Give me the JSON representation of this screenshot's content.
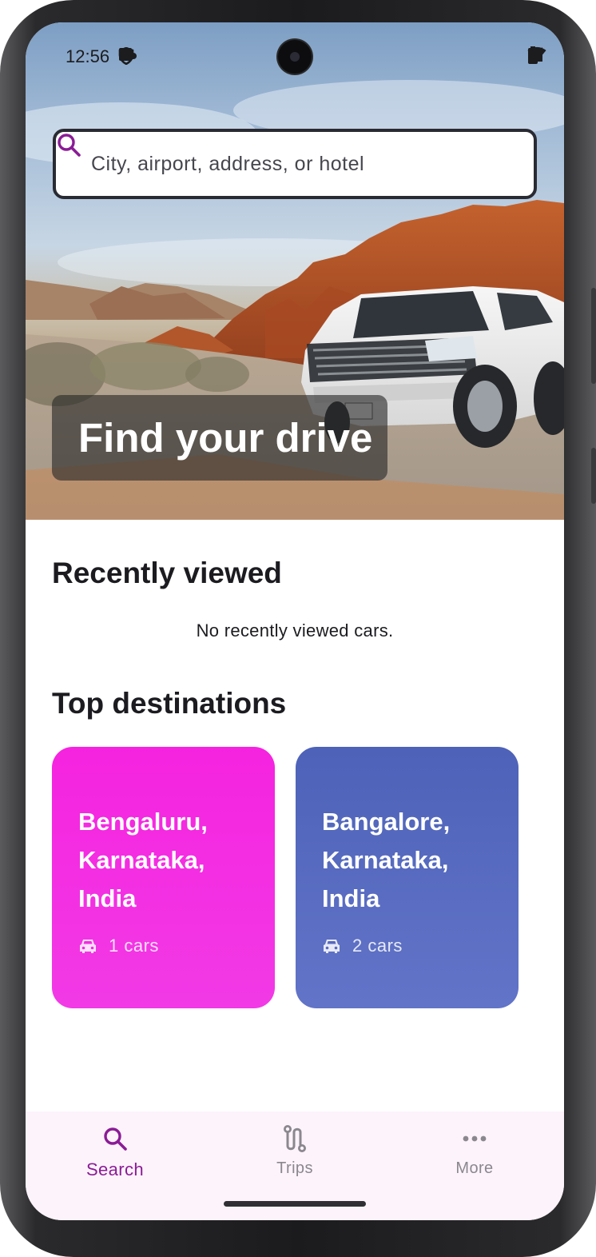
{
  "status_bar": {
    "time": "12:56"
  },
  "search": {
    "placeholder": "City, airport, address, or hotel"
  },
  "hero": {
    "headline": "Find your drive"
  },
  "recently_viewed": {
    "title": "Recently viewed",
    "empty_message": "No recently viewed cars."
  },
  "top_destinations": {
    "title": "Top destinations",
    "cards": [
      {
        "name": "Bengaluru, Karnataka, India",
        "cars": "1 cars",
        "color": "#f02ce0"
      },
      {
        "name": "Bangalore, Karnataka, India",
        "cars": "2 cars",
        "color": "#5668c0"
      }
    ]
  },
  "bottom_nav": {
    "items": [
      {
        "label": "Search",
        "icon": "search-icon",
        "active": true
      },
      {
        "label": "Trips",
        "icon": "trips-icon",
        "active": false
      },
      {
        "label": "More",
        "icon": "more-icon",
        "active": false
      }
    ]
  },
  "colors": {
    "accent": "#8b1c96",
    "nav_background": "#fdf3fb",
    "inactive": "#8b878f"
  }
}
